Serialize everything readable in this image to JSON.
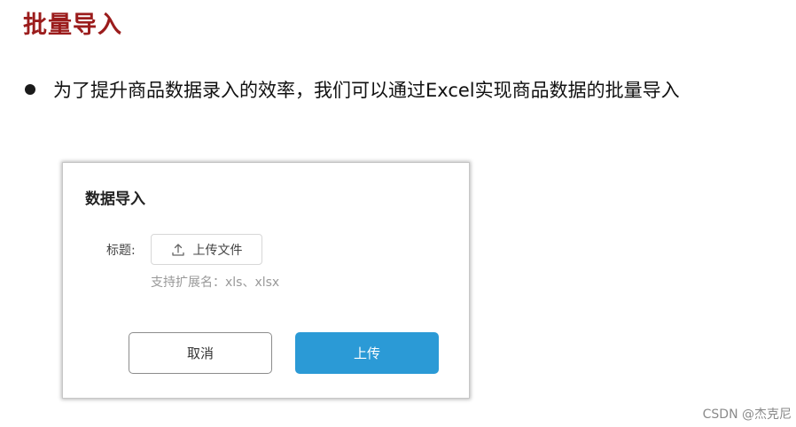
{
  "slide": {
    "title": "批量导入",
    "bullet": "为了提升商品数据录入的效率，我们可以通过Excel实现商品数据的批量导入"
  },
  "dialog": {
    "title": "数据导入",
    "field_label": "标题:",
    "upload_button_label": "上传文件",
    "hint": "支持扩展名：xls、xlsx",
    "cancel_label": "取消",
    "submit_label": "上传",
    "accent_color": "#2b9ad6"
  },
  "watermark": "CSDN @杰克尼"
}
